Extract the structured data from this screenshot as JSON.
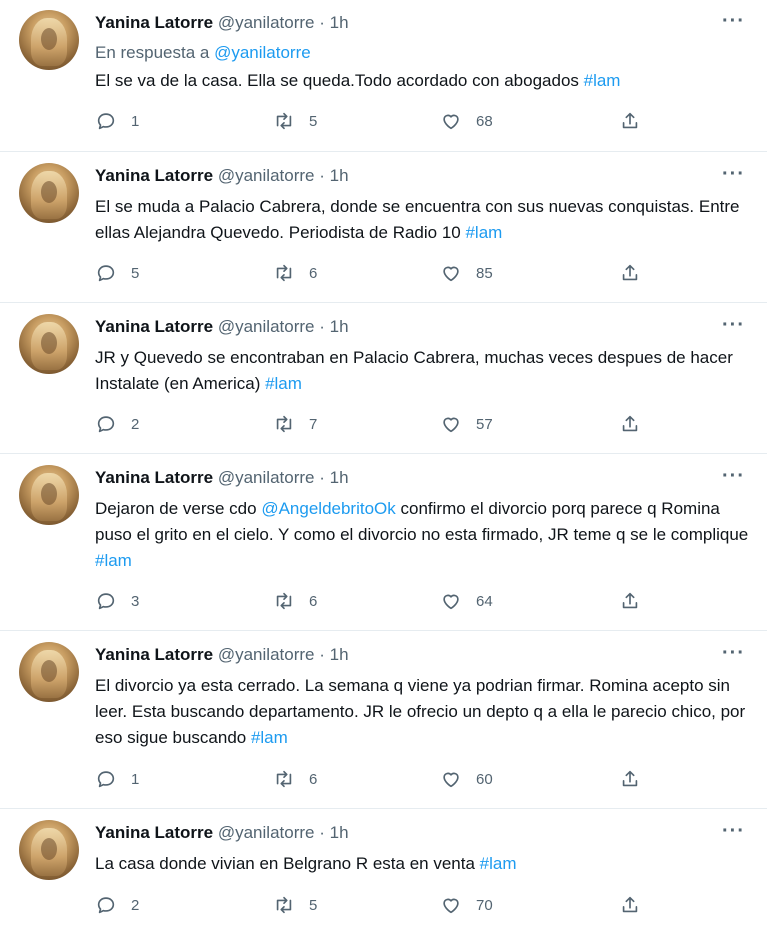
{
  "tweets": [
    {
      "name": "Yanina Latorre",
      "handle": "@yanilatorre",
      "dot": "·",
      "time": "1h",
      "more": "···",
      "reply_prefix": "En respuesta a ",
      "reply_mention": "@yanilatorre",
      "text": "El se va de la casa. Ella se queda.Todo acordado con abogados ",
      "hashtag": "#lam",
      "replies": "1",
      "retweets": "5",
      "likes": "68"
    },
    {
      "name": "Yanina Latorre",
      "handle": "@yanilatorre",
      "dot": "·",
      "time": "1h",
      "more": "···",
      "text": "El se muda a Palacio Cabrera, donde se encuentra con sus nuevas conquistas. Entre ellas Alejandra Quevedo. Periodista de Radio 10 ",
      "hashtag": "#lam",
      "replies": "5",
      "retweets": "6",
      "likes": "85"
    },
    {
      "name": "Yanina Latorre",
      "handle": "@yanilatorre",
      "dot": "·",
      "time": "1h",
      "more": "···",
      "text": "JR y Quevedo se encontraban en Palacio Cabrera, muchas veces despues de hacer Instalate (en America) ",
      "hashtag": "#lam",
      "replies": "2",
      "retweets": "7",
      "likes": "57"
    },
    {
      "name": "Yanina Latorre",
      "handle": "@yanilatorre",
      "dot": "·",
      "time": "1h",
      "more": "···",
      "text_before": "Dejaron de verse cdo ",
      "mention": "@AngeldebritoOk",
      "text": " confirmo el divorcio porq parece q Romina puso el grito en el cielo. Y como el divorcio no esta firmado, JR teme q se le complique ",
      "hashtag": "#lam",
      "replies": "3",
      "retweets": "6",
      "likes": "64"
    },
    {
      "name": "Yanina Latorre",
      "handle": "@yanilatorre",
      "dot": "·",
      "time": "1h",
      "more": "···",
      "text": "El divorcio ya esta cerrado. La semana q viene ya podrian firmar. Romina acepto sin leer. Esta buscando departamento. JR le ofrecio un depto q a ella le parecio chico, por eso sigue buscando ",
      "hashtag": "#lam",
      "replies": "1",
      "retweets": "6",
      "likes": "60"
    },
    {
      "name": "Yanina Latorre",
      "handle": "@yanilatorre",
      "dot": "·",
      "time": "1h",
      "more": "···",
      "text": "La casa donde vivian en Belgrano R esta en venta ",
      "hashtag": "#lam",
      "replies": "2",
      "retweets": "5",
      "likes": "70"
    }
  ]
}
